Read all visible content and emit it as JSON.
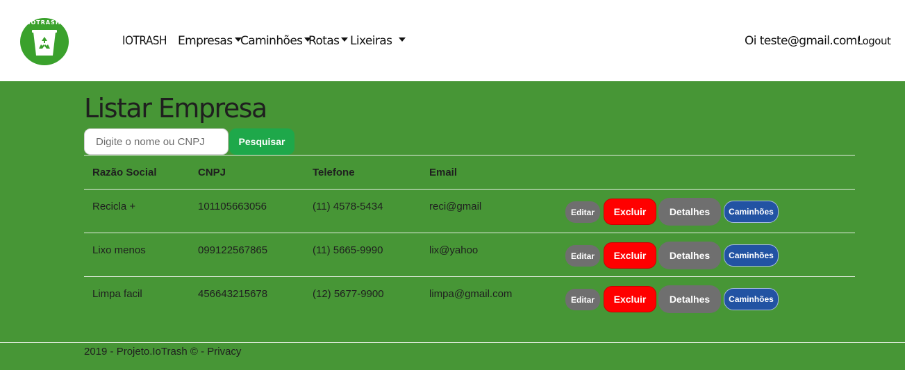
{
  "nav": {
    "logo_text": "IOTRASH",
    "brand": "IOTRASH",
    "items": [
      {
        "label": "Empresas"
      },
      {
        "label": "Caminhões"
      },
      {
        "label": "Rotas"
      },
      {
        "label": "Lixeiras"
      }
    ],
    "greeting": "Oi teste@gmail.com!",
    "logout": "Logout"
  },
  "page": {
    "title": "Listar Empresa",
    "search_placeholder": "Digite o nome ou CNPJ",
    "search_button": "Pesquisar"
  },
  "table": {
    "headers": [
      "Razão Social",
      "CNPJ",
      "Telefone",
      "Email"
    ],
    "actions": {
      "edit": "Editar",
      "delete": "Excluir",
      "details": "Detalhes",
      "trucks": "Caminhões"
    },
    "rows": [
      {
        "razao": "Recicla +",
        "cnpj": "101105663056",
        "telefone": "(11) 4578-5434",
        "email": "reci@gmail"
      },
      {
        "razao": "Lixo menos",
        "cnpj": "099122567865",
        "telefone": "(11) 5665-9990",
        "email": "lix@yahoo"
      },
      {
        "razao": "Limpa facil",
        "cnpj": "456643215678",
        "telefone": "(12) 5677-9900",
        "email": "limpa@gmail.com"
      }
    ]
  },
  "footer": {
    "text": "2019 - Projeto.IoTrash © - ",
    "privacy": "Privacy"
  },
  "colors": {
    "background": "#479636",
    "excluir": "#ff0000",
    "caminhoes": "#2253a3",
    "pesquisar": "#1ea84a"
  }
}
